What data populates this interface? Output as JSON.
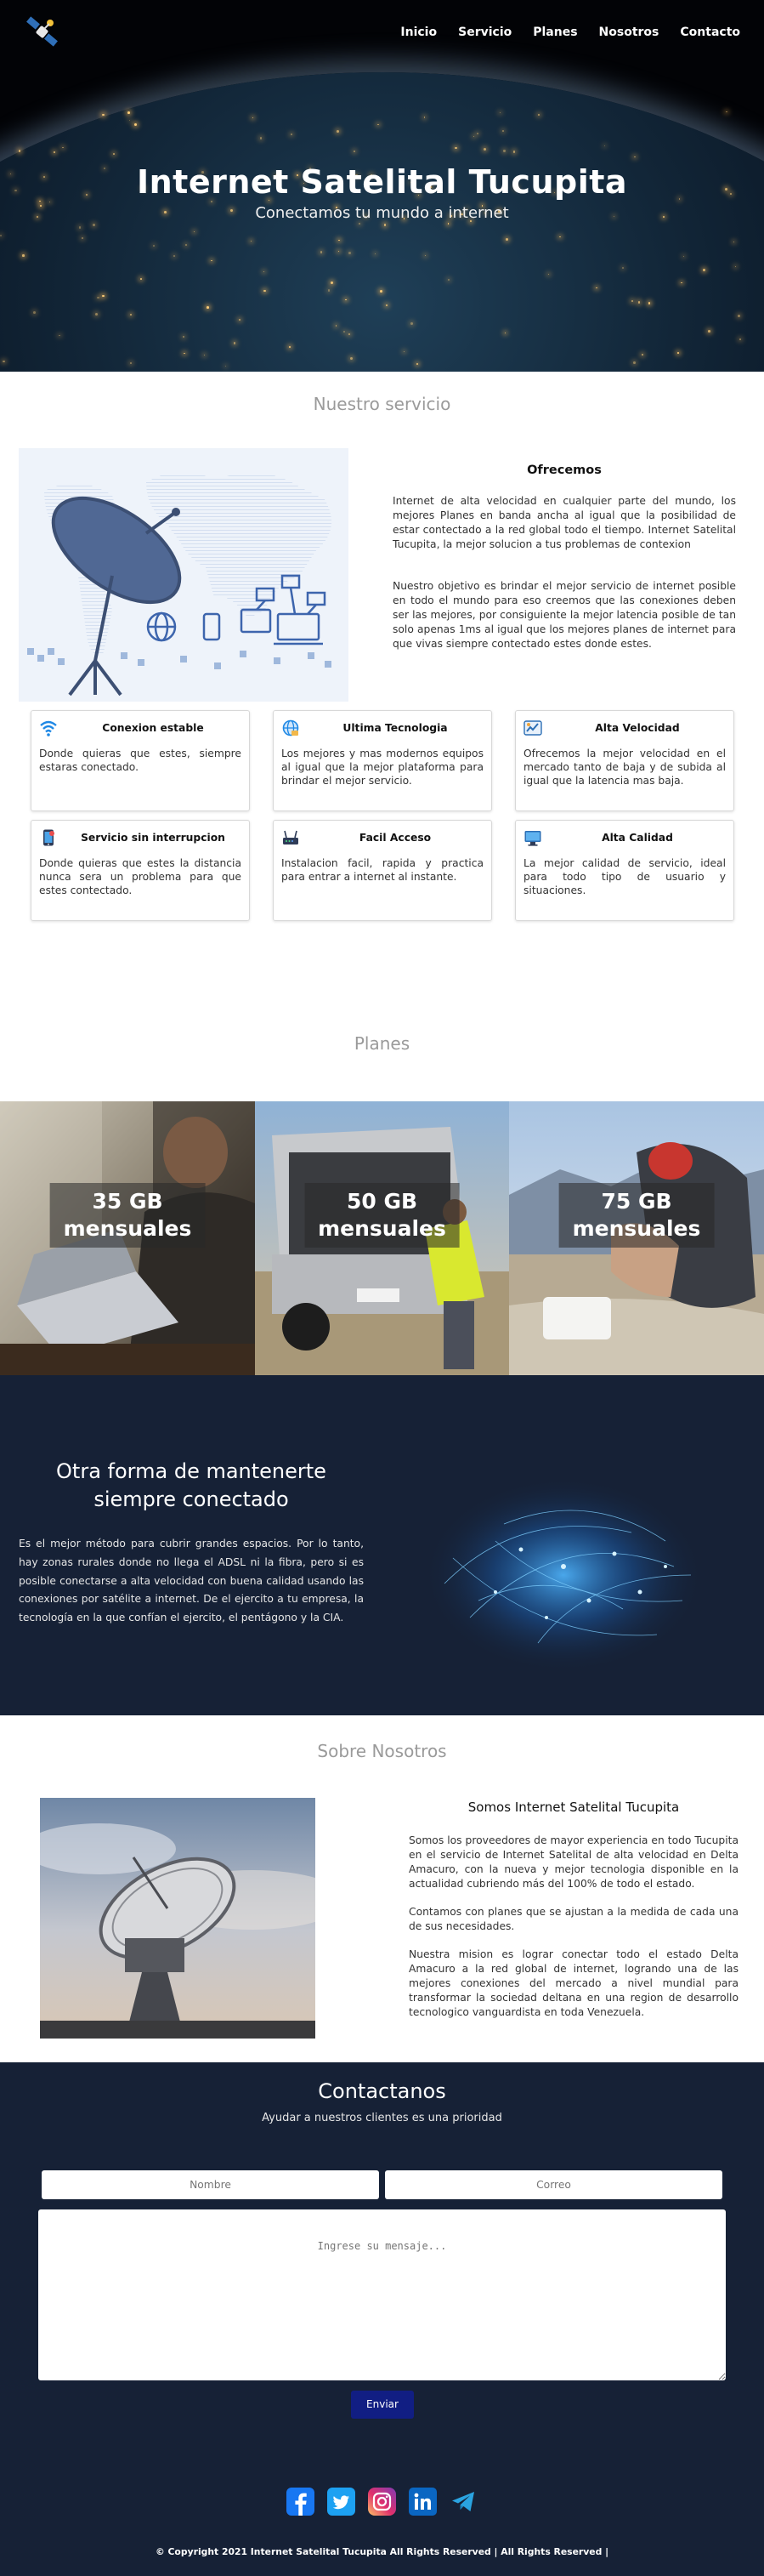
{
  "nav": {
    "links": [
      "Inicio",
      "Servicio",
      "Planes",
      "Nosotros",
      "Contacto"
    ]
  },
  "hero": {
    "title": "Internet Satelital Tucupita",
    "subtitle": "Conectamos tu mundo a internet"
  },
  "servicio": {
    "section_title": "Nuestro servicio",
    "heading": "Ofrecemos",
    "paragraphs": [
      "Internet de alta velocidad en cualquier parte del mundo, los mejores Planes en banda ancha al igual que la posibilidad de estar contectado a la red global todo el tiempo. Internet Satelital Tucupita, la mejor solucion a tus problemas de contexion",
      "Nuestro objetivo es brindar el mejor servicio de internet posible en todo el mundo para eso creemos que las conexiones deben ser las mejores, por consiguiente la mejor latencia posible de tan solo apenas 1ms al igual que los mejores planes de internet para que vivas siempre contectado estes donde estes."
    ],
    "cards": [
      {
        "title": "Conexion estable",
        "icon": "wifi-icon",
        "text": "Donde quieras que estes, siempre estaras conectado."
      },
      {
        "title": "Ultima Tecnologia",
        "icon": "globe-icon",
        "text": "Los mejores y mas modernos equipos al igual que la mejor plataforma para brindar el mejor servicio."
      },
      {
        "title": "Alta Velocidad",
        "icon": "speed-icon",
        "text": "Ofrecemos la mejor velocidad en el mercado tanto de baja y de subida al igual que la latencia mas baja."
      },
      {
        "title": "Servicio sin interrupcion",
        "icon": "phone-icon",
        "text": "Donde quieras que estes la distancia nunca sera un problema para que estes contectado."
      },
      {
        "title": "Facil Acceso",
        "icon": "router-icon",
        "text": "Instalacion facil, rapida y practica para entrar a internet al instante."
      },
      {
        "title": "Alta Calidad",
        "icon": "monitor-icon",
        "text": "La mejor calidad de servicio, ideal para todo tipo de usuario y situaciones."
      }
    ]
  },
  "planes": {
    "section_title": "Planes",
    "items": [
      {
        "gb": "35 GB",
        "period": "mensuales"
      },
      {
        "gb": "50 GB",
        "period": "mensuales"
      },
      {
        "gb": "75 GB",
        "period": "mensuales"
      }
    ]
  },
  "otra": {
    "title": "Otra forma de mantenerte siempre conectado",
    "text": "Es el mejor método para cubrir grandes espacios. Por lo tanto, hay zonas rurales donde no llega el ADSL ni la fibra, pero si es posible conectarse a alta velocidad con buena calidad usando las conexiones por satélite a internet. De el ejercito a tu empresa, la tecnología en la que confían el ejercito, el pentágono y la CIA."
  },
  "nosotros": {
    "section_title": "Sobre Nosotros",
    "heading": "Somos Internet Satelital Tucupita",
    "paragraphs": [
      "Somos los proveedores de mayor experiencia en todo Tucupita en el servicio de Internet Satelital de alta velocidad en Delta Amacuro, con la nueva y mejor tecnologia disponible en la actualidad cubriendo más del 100% de todo el estado.",
      "Contamos con planes que se ajustan a la medida de cada una de sus necesidades.",
      "Nuestra mision es lograr conectar todo el estado Delta Amacuro a la red global de internet, logrando una de las mejores conexiones del mercado a nivel mundial para transformar la sociedad deltana en una region de desarrollo tecnologico vanguardista en toda Venezuela."
    ]
  },
  "contacto": {
    "title": "Contactanos",
    "subtitle": "Ayudar a nuestros clientes es una prioridad",
    "name_placeholder": "Nombre",
    "email_placeholder": "Correo",
    "message_placeholder": "Ingrese su mensaje...",
    "send_label": "Enviar",
    "socials": [
      "facebook-icon",
      "twitter-icon",
      "instagram-icon",
      "linkedin-icon",
      "telegram-icon"
    ],
    "copyright": "© Copyright 2021 Internet Satelital Tucupita All Rights Reserved | All Rights Reserved |"
  },
  "colors": {
    "dark_navy": "#162136",
    "send_button": "#111e83"
  }
}
